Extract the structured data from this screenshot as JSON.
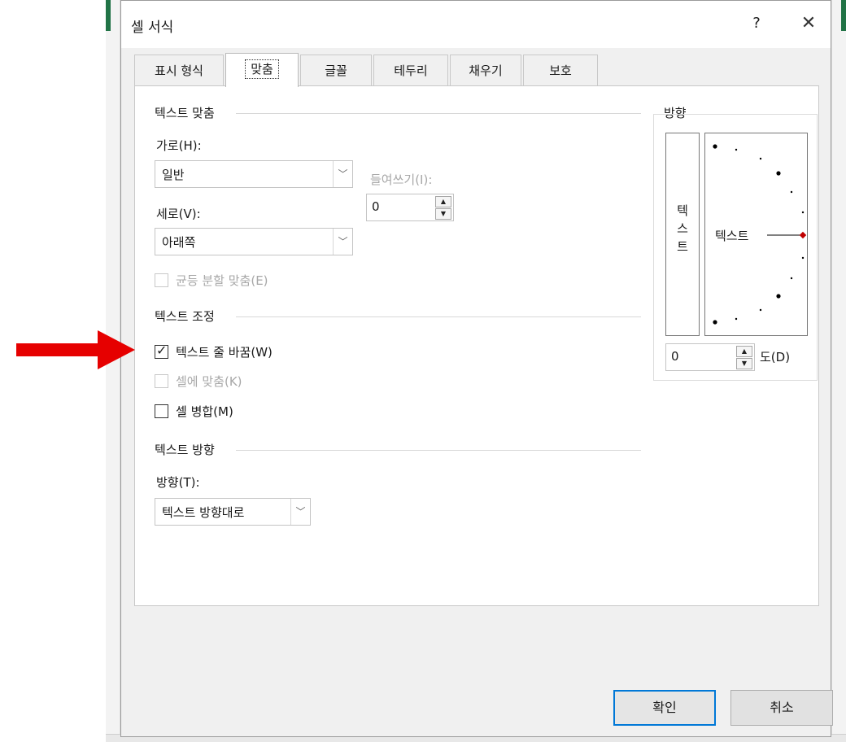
{
  "dialog": {
    "title": "셀 서식",
    "help": "?",
    "close": "✕"
  },
  "tabs": [
    "표시 형식",
    "맞춤",
    "글꼴",
    "테두리",
    "채우기",
    "보호"
  ],
  "text_alignment": {
    "section": "텍스트 맞춤",
    "horizontal_label": "가로(H):",
    "horizontal_value": "일반",
    "indent_label": "들여쓰기(I):",
    "indent_value": "0",
    "vertical_label": "세로(V):",
    "vertical_value": "아래쪽",
    "distributed_label": "균등 분할 맞춤(E)"
  },
  "text_control": {
    "section": "텍스트 조정",
    "wrap_label": "텍스트 줄 바꿈(W)",
    "wrap_checked": true,
    "shrink_label": "셀에 맞춤(K)",
    "merge_label": "셀 병합(M)"
  },
  "text_direction": {
    "section": "텍스트 방향",
    "direction_label": "방향(T):",
    "direction_value": "텍스트 방향대로"
  },
  "orientation": {
    "section": "방향",
    "vertical_text": [
      "텍",
      "스",
      "트"
    ],
    "dial_text": "텍스트",
    "degree_value": "0",
    "degree_label": "도(D)"
  },
  "buttons": {
    "ok": "확인",
    "cancel": "취소"
  },
  "colors": {
    "accent": "#0078d7",
    "arrow": "#e60000",
    "dial_marker": "#c00000"
  }
}
